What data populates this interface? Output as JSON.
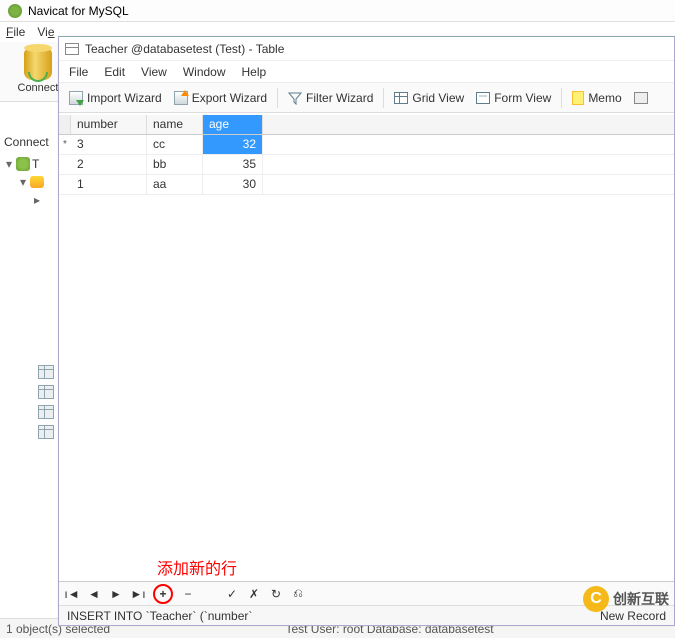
{
  "main": {
    "title": "Navicat for MySQL",
    "menubar": [
      "File",
      "View"
    ],
    "toolbar": {
      "connection_label": "Connect"
    },
    "sidebar_label": "Connect",
    "tree": {
      "row1": "T",
      "row2": ""
    },
    "statusbar": {
      "left": "1 object(s) selected",
      "mid": "Test   User: root   Database: databasetest"
    }
  },
  "child": {
    "title": "Teacher @databasetest (Test) - Table",
    "menubar": [
      "File",
      "Edit",
      "View",
      "Window",
      "Help"
    ],
    "toolbar": {
      "import": "Import Wizard",
      "export": "Export Wizard",
      "filter": "Filter Wizard",
      "grid": "Grid View",
      "form": "Form View",
      "memo": "Memo"
    },
    "grid": {
      "columns": {
        "number": "number",
        "name": "name",
        "age": "age"
      },
      "rows": [
        {
          "marker": "*",
          "number": "3",
          "name": "cc",
          "age": "32",
          "selected": true
        },
        {
          "marker": "",
          "number": "2",
          "name": "bb",
          "age": "35",
          "selected": false
        },
        {
          "marker": "",
          "number": "1",
          "name": "aa",
          "age": "30",
          "selected": false
        }
      ]
    },
    "nav": {
      "first": "ı◄",
      "prev": "◄",
      "next": "►",
      "last": "►ı",
      "plus": "+",
      "minus": "−",
      "edit": "✎",
      "check": "✓",
      "cancel": "✗",
      "refresh": "↻",
      "bookmark": "⎌"
    },
    "annotation": "添加新的行",
    "status": {
      "left": "INSERT INTO `Teacher` (`number`",
      "right": "New Record"
    }
  },
  "watermark": {
    "c": "C",
    "text": "创新互联"
  }
}
